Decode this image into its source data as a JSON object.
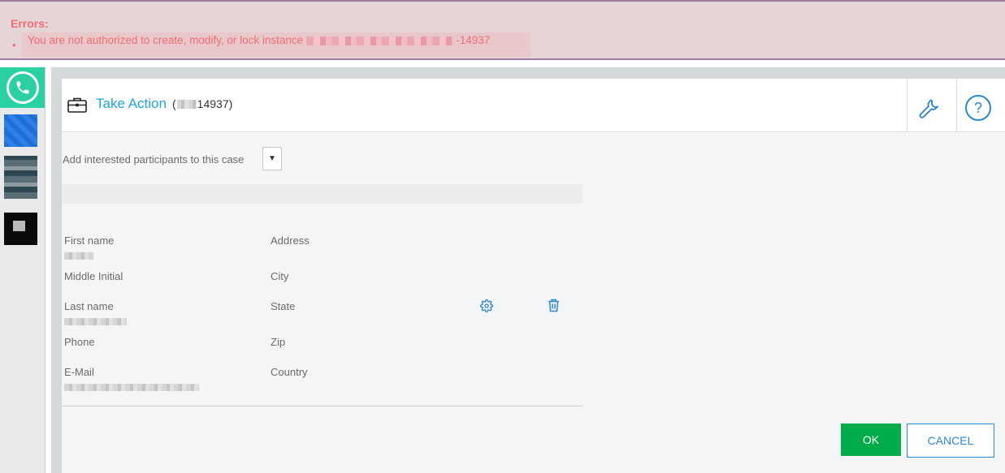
{
  "error": {
    "title": "Errors:",
    "bullet": "•",
    "message_prefix": "You are not authorized to create, modify, or lock instance",
    "message_suffix": "-14937"
  },
  "dock": {
    "items": [
      {
        "icon": "phone-icon"
      },
      {
        "icon": "app-blue-icon"
      },
      {
        "icon": "app-photo-icon"
      },
      {
        "icon": "app-black-icon"
      }
    ]
  },
  "header": {
    "icon": "briefcase-icon",
    "title": "Take Action",
    "id_open": "(",
    "id_suffix": "14937)",
    "help_label": "?"
  },
  "participants": {
    "label": "Add interested participants to this case",
    "dropdown_glyph": "▼"
  },
  "fields": {
    "first_name": "First name",
    "middle_initial": "Middle Initial",
    "last_name": "Last name",
    "phone": "Phone",
    "email": "E-Mail",
    "address": "Address",
    "city": "City",
    "state": "State",
    "zip": "Zip",
    "country": "Country"
  },
  "buttons": {
    "ok": "OK",
    "cancel": "CANCEL"
  },
  "colors": {
    "accent_blue": "#1ea5db",
    "ok_green": "#00ac49",
    "error_red": "#f06c72",
    "dock_teal": "#2bd0a2"
  }
}
